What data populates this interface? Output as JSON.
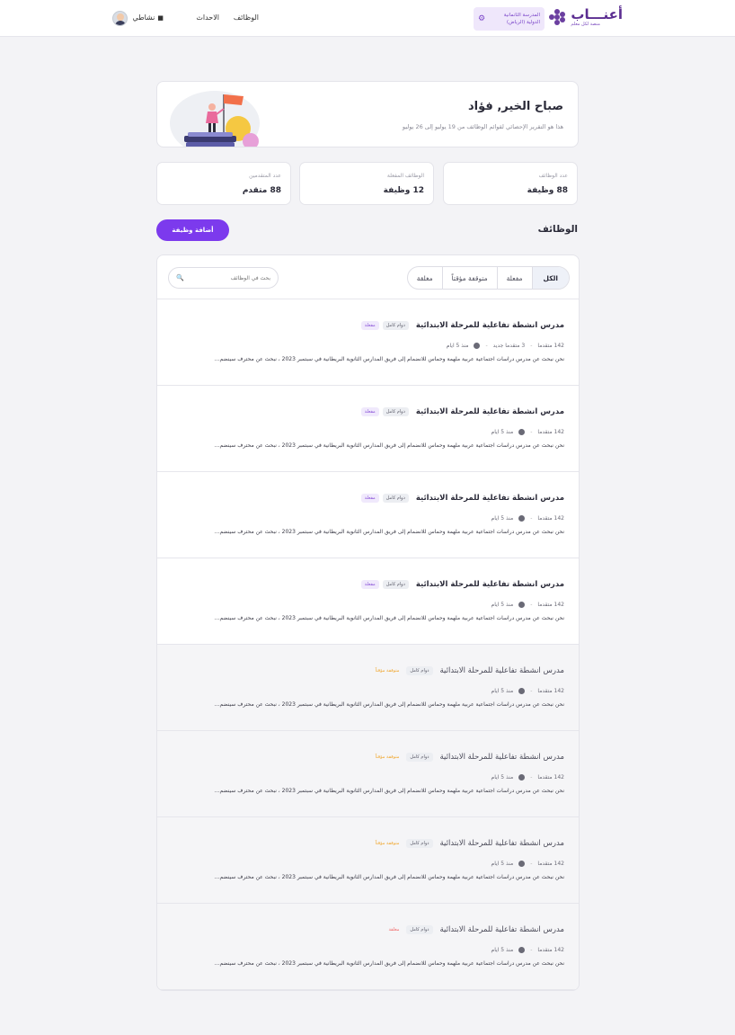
{
  "header": {
    "logo_title": "أعنـــاب",
    "logo_sub": "منصة لكل معلم",
    "school_name": "المدرسة الثانمانية الدولية (الرياض)",
    "nav": {
      "jobs": "الوظائف",
      "events": "الاحداث",
      "activity": "نشاطي"
    }
  },
  "greeting": {
    "title": "صباح الخير, فؤاد",
    "subtitle": "هذا هو التقرير الإحصائي لقوائم الوظائف من 19 يوليو إلى 26 يوليو"
  },
  "stats": [
    {
      "label": "عدد الوظائف",
      "value": "88 وظيفة"
    },
    {
      "label": "الوظائف المفعلة",
      "value": "12 وظيفة"
    },
    {
      "label": "عدد المتقدمين",
      "value": "88 متقدم"
    }
  ],
  "jobs_section": {
    "title": "الوظائف",
    "add_button": "أضافة وظيفة",
    "tabs": [
      "الكل",
      "مفعلة",
      "متوقفة مؤقتاً",
      "مغلقة"
    ],
    "search_placeholder": "بحث في الوظائف",
    "jobs": [
      {
        "title": "مدرس انشطة تفاعلية للمرحلة الابتدائية",
        "type": "دوام كامل",
        "status": "مفعلة",
        "status_kind": "active",
        "applicants": "142 متقدما",
        "new_applicants": "3 متقدما جديد",
        "posted": "منذ 5 ايام",
        "desc": "نحن نبحث عن مدرس دراسات اجتماعية عربية ملهمة وحماس للانضمام إلى فريق المدارس الثانوية البريطانية في سبتمبر 2023 ، نبحث عن محترف سينضم..."
      },
      {
        "title": "مدرس انشطة تفاعلية للمرحلة الابتدائية",
        "type": "دوام كامل",
        "status": "مفعلة",
        "status_kind": "active",
        "applicants": "142 متقدما",
        "new_applicants": "",
        "posted": "منذ 5 ايام",
        "desc": "نحن نبحث عن مدرس دراسات اجتماعية عربية ملهمة وحماس للانضمام إلى فريق المدارس الثانوية البريطانية في سبتمبر 2023 ، نبحث عن محترف سينضم..."
      },
      {
        "title": "مدرس انشطة تفاعلية للمرحلة الابتدائية",
        "type": "دوام كامل",
        "status": "مفعلة",
        "status_kind": "active",
        "applicants": "142 متقدما",
        "new_applicants": "",
        "posted": "منذ 5 ايام",
        "desc": "نحن نبحث عن مدرس دراسات اجتماعية عربية ملهمة وحماس للانضمام إلى فريق المدارس الثانوية البريطانية في سبتمبر 2023 ، نبحث عن محترف سينضم..."
      },
      {
        "title": "مدرس انشطة تفاعلية للمرحلة الابتدائية",
        "type": "دوام كامل",
        "status": "مفعلة",
        "status_kind": "active",
        "applicants": "142 متقدما",
        "new_applicants": "",
        "posted": "منذ 5 ايام",
        "desc": "نحن نبحث عن مدرس دراسات اجتماعية عربية ملهمة وحماس للانضمام إلى فريق المدارس الثانوية البريطانية في سبتمبر 2023 ، نبحث عن محترف سينضم..."
      },
      {
        "title": "مدرس انشطة تفاعلية للمرحلة الابتدائية",
        "type": "دوام كامل",
        "status": "متوقفة مؤقتاً",
        "status_kind": "paused",
        "applicants": "142 متقدما",
        "new_applicants": "",
        "posted": "منذ 5 ايام",
        "desc": "نحن نبحث عن مدرس دراسات اجتماعية عربية ملهمة وحماس للانضمام إلى فريق المدارس الثانوية البريطانية في سبتمبر 2023 ، نبحث عن محترف سينضم..."
      },
      {
        "title": "مدرس انشطة تفاعلية للمرحلة الابتدائية",
        "type": "دوام كامل",
        "status": "متوقفة مؤقتاً",
        "status_kind": "paused",
        "applicants": "142 متقدما",
        "new_applicants": "",
        "posted": "منذ 5 ايام",
        "desc": "نحن نبحث عن مدرس دراسات اجتماعية عربية ملهمة وحماس للانضمام إلى فريق المدارس الثانوية البريطانية في سبتمبر 2023 ، نبحث عن محترف سينضم..."
      },
      {
        "title": "مدرس انشطة تفاعلية للمرحلة الابتدائية",
        "type": "دوام كامل",
        "status": "متوقفة مؤقتاً",
        "status_kind": "paused",
        "applicants": "142 متقدما",
        "new_applicants": "",
        "posted": "منذ 5 ايام",
        "desc": "نحن نبحث عن مدرس دراسات اجتماعية عربية ملهمة وحماس للانضمام إلى فريق المدارس الثانوية البريطانية في سبتمبر 2023 ، نبحث عن محترف سينضم..."
      },
      {
        "title": "مدرس انشطة تفاعلية للمرحلة الابتدائية",
        "type": "دوام كامل",
        "status": "مغلقة",
        "status_kind": "closed",
        "applicants": "142 متقدما",
        "new_applicants": "",
        "posted": "منذ 5 ايام",
        "desc": "نحن نبحث عن مدرس دراسات اجتماعية عربية ملهمة وحماس للانضمام إلى فريق المدارس الثانوية البريطانية في سبتمبر 2023 ، نبحث عن محترف سينضم..."
      }
    ]
  },
  "colors": {
    "accent": "#7c3aed",
    "brand": "#5b2d91",
    "paused": "#f0a52a",
    "closed": "#f06a6a"
  }
}
